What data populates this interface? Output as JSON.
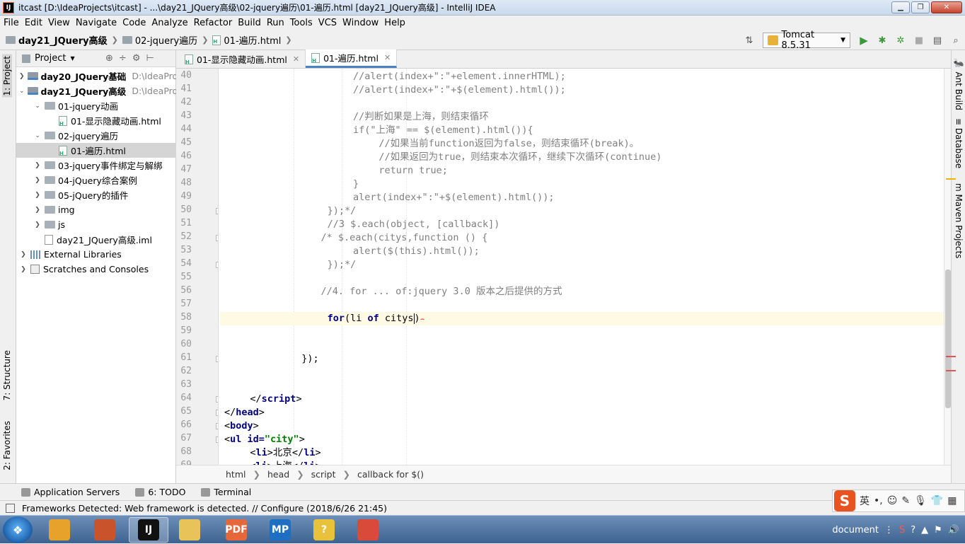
{
  "window": {
    "title": "itcast [D:\\IdeaProjects\\itcast] - ...\\day21_JQuery高级\\02-jquery遍历\\01-遍历.html [day21_JQuery高级] - IntelliJ IDEA",
    "app_icon": "IJ"
  },
  "menu": [
    "File",
    "Edit",
    "View",
    "Navigate",
    "Code",
    "Analyze",
    "Refactor",
    "Build",
    "Run",
    "Tools",
    "VCS",
    "Window",
    "Help"
  ],
  "navbar": {
    "crumbs": [
      "day21_JQuery高级",
      "02-jquery遍历",
      "01-遍历.html"
    ],
    "run_config": "Tomcat 8.5.31"
  },
  "left_strip": {
    "project": "1: Project",
    "structure": "7: Structure",
    "favorites": "2: Favorites"
  },
  "right_strip": {
    "ant": "Ant Build",
    "database": "Database",
    "maven": "Maven Projects"
  },
  "project_panel": {
    "title": "Project",
    "tree": [
      {
        "label": "day20_JQuery基础",
        "path": "D:\\IdeaProje",
        "depth": 0,
        "kind": "module",
        "expanded": false
      },
      {
        "label": "day21_JQuery高级",
        "path": "D:\\IdeaProje",
        "depth": 0,
        "kind": "module",
        "expanded": true
      },
      {
        "label": "01-jquery动画",
        "depth": 1,
        "kind": "folder",
        "expanded": true
      },
      {
        "label": "01-显示隐藏动画.html",
        "depth": 2,
        "kind": "html"
      },
      {
        "label": "02-jquery遍历",
        "depth": 1,
        "kind": "folder",
        "expanded": true
      },
      {
        "label": "01-遍历.html",
        "depth": 2,
        "kind": "html",
        "selected": true
      },
      {
        "label": "03-jquery事件绑定与解绑",
        "depth": 1,
        "kind": "folder",
        "expanded": false
      },
      {
        "label": "04-jQuery综合案例",
        "depth": 1,
        "kind": "folder",
        "expanded": false
      },
      {
        "label": "05-jQuery的插件",
        "depth": 1,
        "kind": "folder",
        "expanded": false
      },
      {
        "label": "img",
        "depth": 1,
        "kind": "folder",
        "expanded": false
      },
      {
        "label": "js",
        "depth": 1,
        "kind": "folder",
        "expanded": false
      },
      {
        "label": "day21_JQuery高级.iml",
        "depth": 1,
        "kind": "iml"
      },
      {
        "label": "External Libraries",
        "depth": 0,
        "kind": "lib",
        "expanded": false
      },
      {
        "label": "Scratches and Consoles",
        "depth": 0,
        "kind": "scratch",
        "expanded": false
      }
    ]
  },
  "editor": {
    "tabs": [
      {
        "label": "01-显示隐藏动画.html",
        "active": false
      },
      {
        "label": "01-遍历.html",
        "active": true
      }
    ],
    "current_line": 58,
    "lines": [
      {
        "n": "40",
        "indent": 20,
        "parts": [
          {
            "t": "//alert(index+\":\"+element.innerHTML);",
            "c": "cm"
          }
        ]
      },
      {
        "n": "41",
        "indent": 20,
        "parts": [
          {
            "t": "//alert(index+\":\"+$(element).html());",
            "c": "cm"
          }
        ]
      },
      {
        "n": "42",
        "indent": 0,
        "parts": []
      },
      {
        "n": "43",
        "indent": 20,
        "parts": [
          {
            "t": "//判断如果是上海，则结束循环",
            "c": "cm"
          }
        ]
      },
      {
        "n": "44",
        "indent": 20,
        "parts": [
          {
            "t": "if(\"上海\" == $(element).html()){",
            "c": "cm"
          }
        ]
      },
      {
        "n": "45",
        "indent": 24,
        "parts": [
          {
            "t": "//如果当前function返回为false，则结束循环(break)。",
            "c": "cm"
          }
        ]
      },
      {
        "n": "46",
        "indent": 24,
        "parts": [
          {
            "t": "//如果返回为true，则结束本次循环，继续下次循环(continue)",
            "c": "cm"
          }
        ]
      },
      {
        "n": "47",
        "indent": 24,
        "parts": [
          {
            "t": "return true;",
            "c": "cm"
          }
        ]
      },
      {
        "n": "48",
        "indent": 20,
        "parts": [
          {
            "t": "}",
            "c": "cm"
          }
        ]
      },
      {
        "n": "49",
        "indent": 20,
        "parts": [
          {
            "t": "alert(index+\":\"+$(element).html());",
            "c": "cm"
          }
        ]
      },
      {
        "n": "50",
        "indent": 16,
        "parts": [
          {
            "t": "});*/",
            "c": "cm"
          }
        ]
      },
      {
        "n": "51",
        "indent": 16,
        "parts": [
          {
            "t": "//3 $.each(object, [callback])",
            "c": "cm"
          }
        ]
      },
      {
        "n": "52",
        "indent": 15,
        "parts": [
          {
            "t": "/* $.each(citys,function () {",
            "c": "cm"
          }
        ]
      },
      {
        "n": "53",
        "indent": 20,
        "parts": [
          {
            "t": "alert($(this).html());",
            "c": "cm"
          }
        ]
      },
      {
        "n": "54",
        "indent": 16,
        "parts": [
          {
            "t": "});*/",
            "c": "cm"
          }
        ]
      },
      {
        "n": "55",
        "indent": 0,
        "parts": []
      },
      {
        "n": "56",
        "indent": 15,
        "parts": [
          {
            "t": "//4. for ... of:jquery 3.0 版本之后提供的方式",
            "c": "cm"
          }
        ]
      },
      {
        "n": "57",
        "indent": 0,
        "parts": []
      },
      {
        "n": "58",
        "indent": 16,
        "parts": [
          {
            "t": "for",
            "c": "kw"
          },
          {
            "t": "(li ",
            "c": ""
          },
          {
            "t": "of",
            "c": "kw"
          },
          {
            "t": " citys",
            "c": ""
          },
          {
            "t": ")",
            "c": ""
          }
        ]
      },
      {
        "n": "59",
        "indent": 0,
        "parts": []
      },
      {
        "n": "60",
        "indent": 0,
        "parts": []
      },
      {
        "n": "61",
        "indent": 12,
        "parts": [
          {
            "t": "});",
            "c": ""
          }
        ]
      },
      {
        "n": "62",
        "indent": 0,
        "parts": []
      },
      {
        "n": "63",
        "indent": 0,
        "parts": []
      },
      {
        "n": "64",
        "indent": 4,
        "parts": [
          {
            "t": "</",
            "c": ""
          },
          {
            "t": "script",
            "c": "tag"
          },
          {
            "t": ">",
            "c": ""
          }
        ]
      },
      {
        "n": "65",
        "indent": 0,
        "parts": [
          {
            "t": "</",
            "c": ""
          },
          {
            "t": "head",
            "c": "tag"
          },
          {
            "t": ">",
            "c": ""
          }
        ]
      },
      {
        "n": "66",
        "indent": 0,
        "parts": [
          {
            "t": "<",
            "c": ""
          },
          {
            "t": "body",
            "c": "tag"
          },
          {
            "t": ">",
            "c": ""
          }
        ]
      },
      {
        "n": "67",
        "indent": 0,
        "parts": [
          {
            "t": "<",
            "c": ""
          },
          {
            "t": "ul ",
            "c": "tag"
          },
          {
            "t": "id=",
            "c": "kw"
          },
          {
            "t": "\"city\"",
            "c": "str"
          },
          {
            "t": ">",
            "c": ""
          }
        ]
      },
      {
        "n": "68",
        "indent": 4,
        "parts": [
          {
            "t": "<",
            "c": ""
          },
          {
            "t": "li",
            "c": "tag"
          },
          {
            "t": ">北京</",
            "c": ""
          },
          {
            "t": "li",
            "c": "tag"
          },
          {
            "t": ">",
            "c": ""
          }
        ]
      },
      {
        "n": "69",
        "indent": 4,
        "parts": [
          {
            "t": "<",
            "c": ""
          },
          {
            "t": "li",
            "c": "tag"
          },
          {
            "t": ">上海</",
            "c": ""
          },
          {
            "t": "li",
            "c": "tag"
          },
          {
            "t": ">",
            "c": ""
          }
        ]
      }
    ],
    "breadcrumb": [
      "html",
      "head",
      "script",
      "callback for $()"
    ]
  },
  "bottom_tabs": [
    "Application Servers",
    "6: TODO",
    "Terminal"
  ],
  "status": {
    "message": "Frameworks Detected: Web framework is detected. // Configure (2018/6/26 21:45)"
  },
  "ime": {
    "logo": "S",
    "lang": "英"
  },
  "taskbar": {
    "apps": [
      {
        "name": "paint-app",
        "glyph": "",
        "color": "#e6a22a"
      },
      {
        "name": "ink-app",
        "glyph": "",
        "color": "#c9532b"
      },
      {
        "name": "intellij-app",
        "glyph": "IJ",
        "color": "#111111",
        "active": true
      },
      {
        "name": "explorer-app",
        "glyph": "",
        "color": "#e8c35a"
      },
      {
        "name": "pdf-app",
        "glyph": "PDF",
        "color": "#e6673a"
      },
      {
        "name": "mp-app",
        "glyph": "MP",
        "color": "#1e6fc4"
      },
      {
        "name": "help-app",
        "glyph": "?",
        "color": "#e8c23a"
      },
      {
        "name": "chrome-app",
        "glyph": "",
        "color": "#d94a3a"
      }
    ],
    "tray_text": "document"
  }
}
